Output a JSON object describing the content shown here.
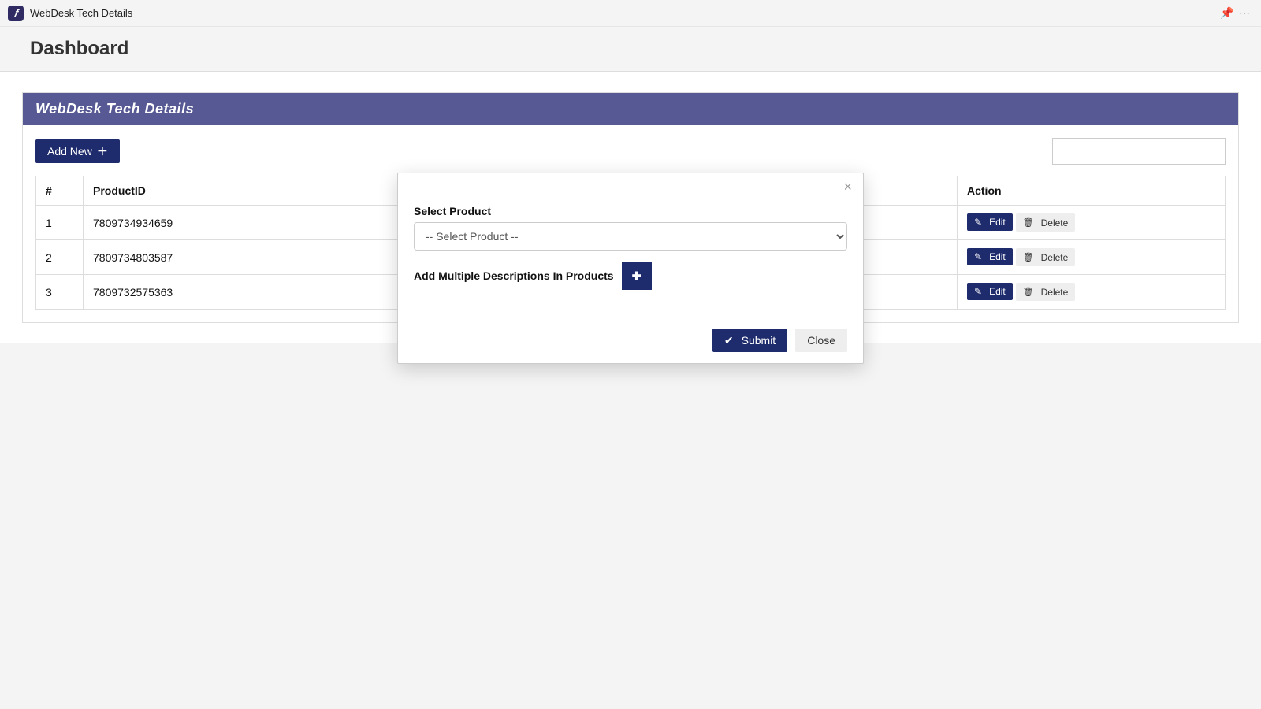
{
  "window": {
    "title": "WebDesk Tech Details"
  },
  "page": {
    "heading": "Dashboard"
  },
  "panel": {
    "title": "WebDesk Tech Details"
  },
  "toolbar": {
    "add_new": "Add New"
  },
  "table": {
    "headers": {
      "index": "#",
      "product_id": "ProductID",
      "action": "Action"
    },
    "rows": [
      {
        "index": "1",
        "product_id": "7809734934659"
      },
      {
        "index": "2",
        "product_id": "7809734803587"
      },
      {
        "index": "3",
        "product_id": "7809732575363"
      }
    ],
    "actions": {
      "edit": "Edit",
      "delete": "Delete"
    }
  },
  "modal": {
    "select_product_label": "Select Product",
    "select_product_placeholder": "-- Select Product --",
    "multi_desc_label": "Add Multiple Descriptions In Products",
    "submit": "Submit",
    "close": "Close"
  }
}
